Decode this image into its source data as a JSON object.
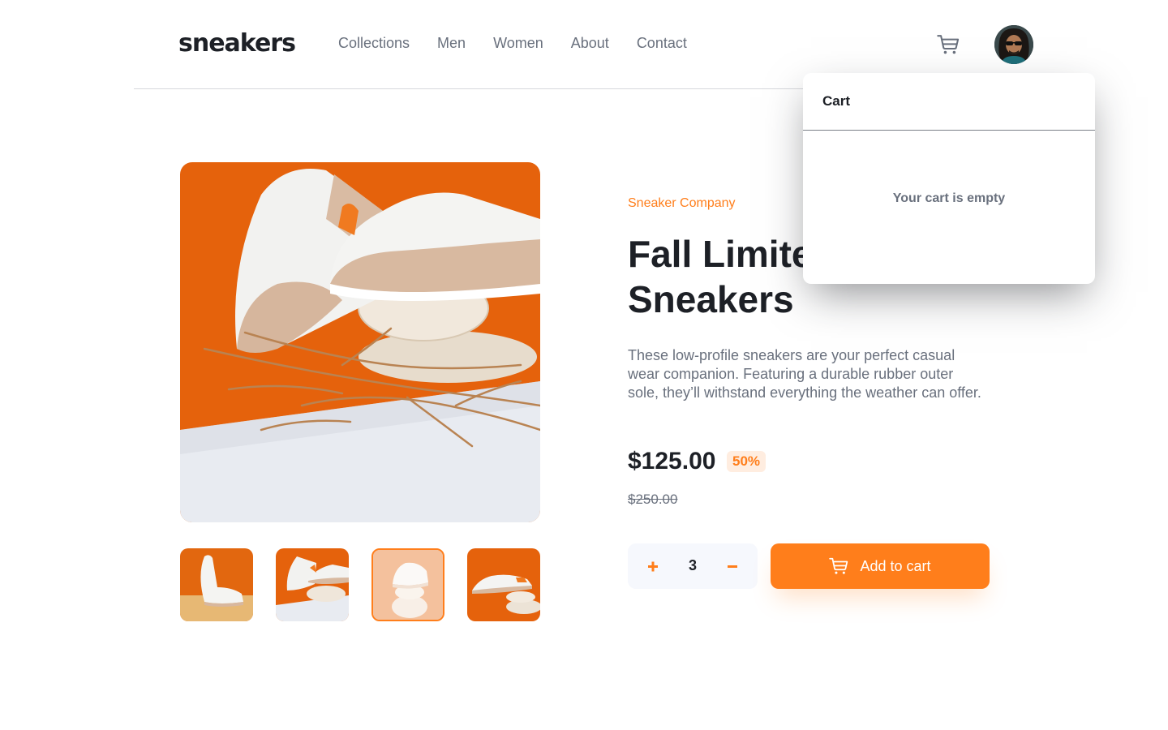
{
  "header": {
    "logo": "sneakers",
    "nav": [
      {
        "label": "Collections"
      },
      {
        "label": "Men"
      },
      {
        "label": "Women"
      },
      {
        "label": "About"
      },
      {
        "label": "Contact"
      }
    ],
    "cart_icon": "cart-icon",
    "avatar_icon": "avatar"
  },
  "gallery": {
    "active_thumbnail": 3,
    "thumbnail_count": 4
  },
  "product": {
    "company": "Sneaker Company",
    "title": "Fall Limited Edition Sneakers",
    "description": "These low-profile sneakers are your perfect casual wear companion. Featuring a durable rubber outer sole, they’ll withstand everything the weather can offer.",
    "price": "$125.00",
    "discount": "50%",
    "original_price": "$250.00"
  },
  "quantity": {
    "value": "3",
    "plus_icon": "plus-icon",
    "minus_icon": "minus-icon"
  },
  "add_to_cart": {
    "label": "Add to cart"
  },
  "cart": {
    "title": "Cart",
    "empty_message": "Your cart is empty"
  },
  "colors": {
    "accent": "#ff7e1b",
    "accent_pale": "#ffede0",
    "text_dark": "#1d2026",
    "text_gray": "#69707d"
  }
}
